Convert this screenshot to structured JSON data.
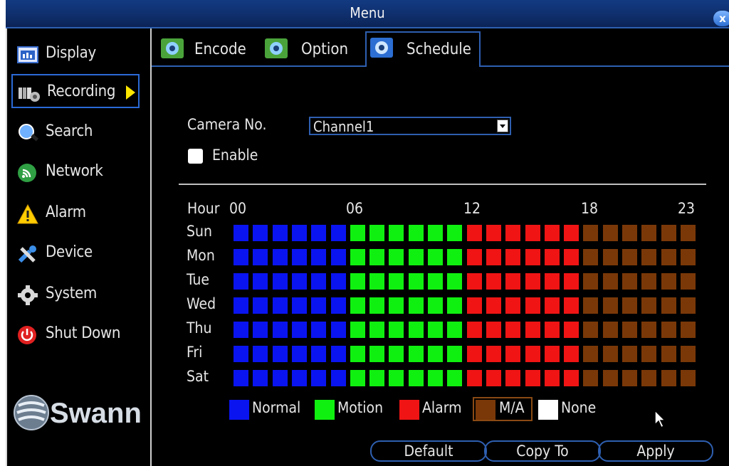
{
  "window": {
    "title": "Menu",
    "close_label": "x"
  },
  "sidebar": {
    "items": [
      {
        "label": "Display",
        "icon": "display-icon"
      },
      {
        "label": "Recording",
        "icon": "recording-icon",
        "active": true
      },
      {
        "label": "Search",
        "icon": "search-icon"
      },
      {
        "label": "Network",
        "icon": "network-icon"
      },
      {
        "label": "Alarm",
        "icon": "alarm-icon"
      },
      {
        "label": "Device",
        "icon": "device-icon"
      },
      {
        "label": "System",
        "icon": "system-icon"
      },
      {
        "label": "Shut Down",
        "icon": "power-icon"
      }
    ],
    "logo_text": "Swann"
  },
  "tabs": [
    {
      "label": "Encode",
      "active": false
    },
    {
      "label": "Option",
      "active": false
    },
    {
      "label": "Schedule",
      "active": true
    }
  ],
  "form": {
    "camera_label": "Camera No.",
    "camera_value": "Channel1",
    "enable_label": "Enable",
    "enable_checked": false
  },
  "schedule": {
    "hour_label": "Hour",
    "hour_ticks": [
      "00",
      "06",
      "12",
      "18",
      "23"
    ],
    "days": [
      "Sun",
      "Mon",
      "Tue",
      "Wed",
      "Thu",
      "Fri",
      "Sat"
    ],
    "mode_by_hour": [
      "Normal",
      "Normal",
      "Normal",
      "Normal",
      "Normal",
      "Normal",
      "Motion",
      "Motion",
      "Motion",
      "Motion",
      "Motion",
      "Motion",
      "Alarm",
      "Alarm",
      "Alarm",
      "Alarm",
      "Alarm",
      "Alarm",
      "M/A",
      "M/A",
      "M/A",
      "M/A",
      "M/A",
      "M/A"
    ]
  },
  "legend": [
    {
      "label": "Normal",
      "color": "#0a14f0"
    },
    {
      "label": "Motion",
      "color": "#10f010"
    },
    {
      "label": "Alarm",
      "color": "#f01414"
    },
    {
      "label": "M/A",
      "color": "#7a3808"
    },
    {
      "label": "None",
      "color": "#ffffff"
    }
  ],
  "buttons": {
    "default": "Default",
    "copy": "Copy To",
    "apply": "Apply"
  }
}
